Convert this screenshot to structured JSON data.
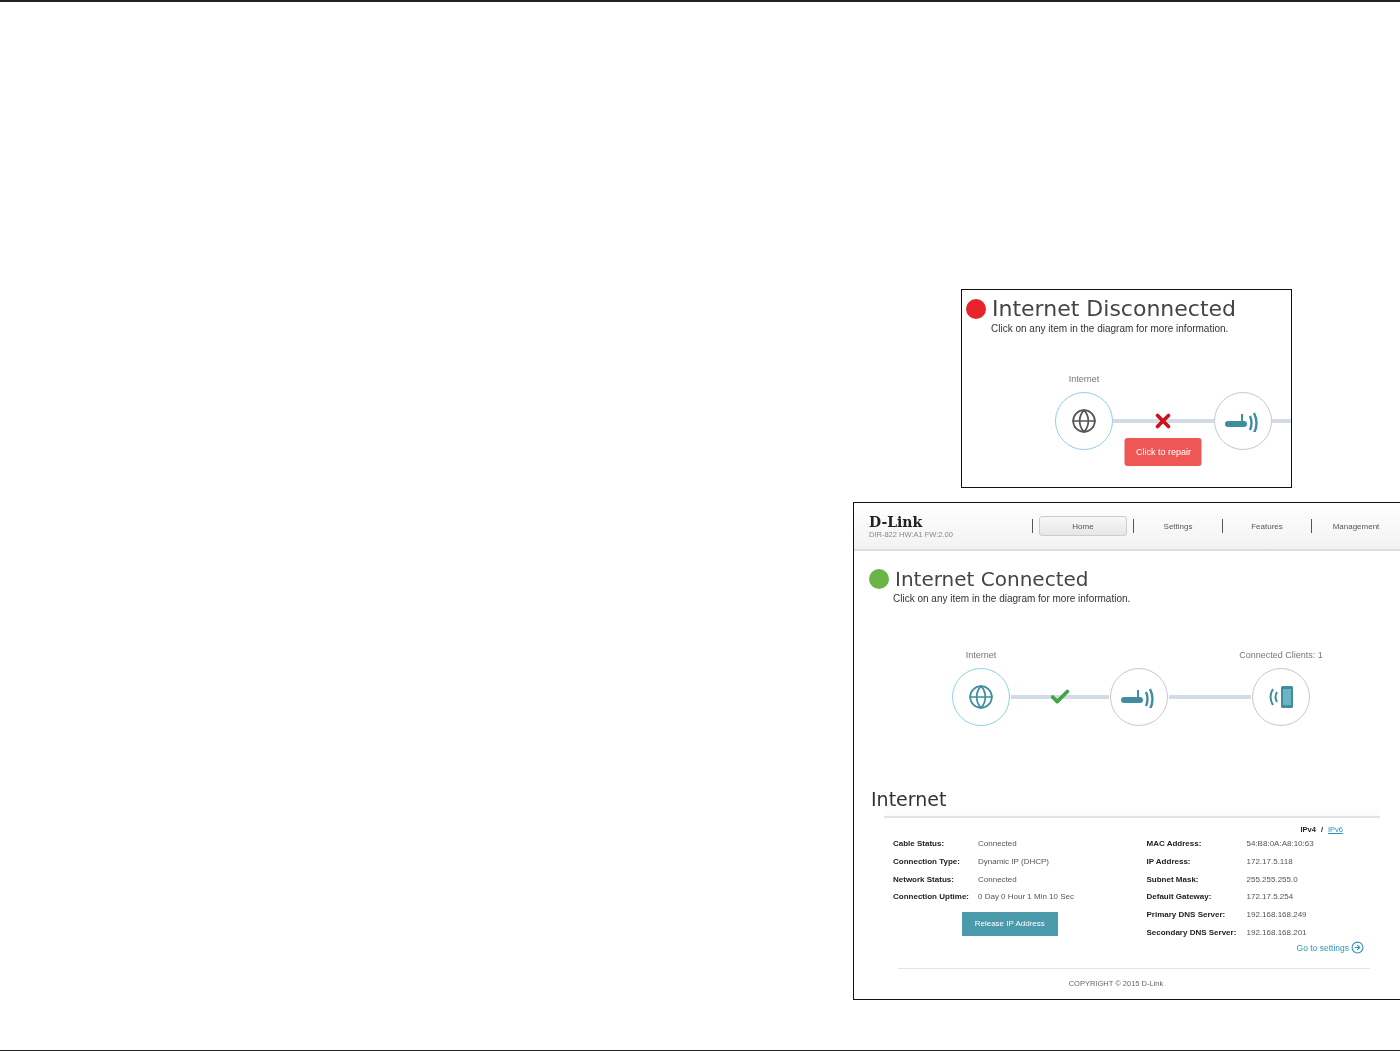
{
  "disconnected_panel": {
    "status": {
      "connected": false,
      "title": "Internet Disconnected"
    },
    "hint": "Click on any item in the diagram for more information.",
    "nodes": [
      {
        "kind": "globe",
        "label": "Internet"
      },
      {
        "kind": "router"
      }
    ],
    "link": {
      "broken": true
    },
    "repair_button": "Click to repair"
  },
  "router_page": {
    "header": {
      "logo": "D-Link",
      "model": "DIR-822 HW:A1 FW:2.00",
      "tabs": [
        {
          "label": "Home",
          "selected": true
        },
        {
          "label": "Settings",
          "selected": false
        },
        {
          "label": "Features",
          "selected": false
        },
        {
          "label": "Management",
          "selected": false
        }
      ]
    },
    "status": {
      "connected": true,
      "title": "Internet Connected"
    },
    "hint": "Click on any item in the diagram for more information.",
    "nodes": [
      {
        "kind": "globe",
        "label": "Internet"
      },
      {
        "kind": "router"
      },
      {
        "kind": "client",
        "label": "Connected Clients: 1"
      }
    ],
    "links": [
      {
        "ok": true
      },
      {
        "ok": false
      }
    ],
    "section_title": "Internet",
    "ip_toggle": {
      "ipv4": "IPv4",
      "separator": "/",
      "ipv6": "IPv6"
    },
    "left_fields": [
      {
        "label": "Cable Status:",
        "value": "Connected"
      },
      {
        "label": "Connection Type:",
        "value": "Dynamic IP (DHCP)"
      },
      {
        "label": "Network Status:",
        "value": "Connected"
      },
      {
        "label": "Connection Uptime:",
        "value": "0 Day 0 Hour 1 Min 10 Sec"
      }
    ],
    "release_button": "Release IP Address",
    "right_fields": [
      {
        "label": "MAC Address:",
        "value": "54:B8:0A:A8:10:63"
      },
      {
        "label": "IP Address:",
        "value": "172.17.5.118"
      },
      {
        "label": "Subnet Mask:",
        "value": "255.255.255.0"
      },
      {
        "label": "Default Gateway:",
        "value": "172.17.5.254"
      },
      {
        "label": "Primary DNS Server:",
        "value": "192.168.168.249"
      },
      {
        "label": "Secondary DNS Server:",
        "value": "192.168.168.201"
      }
    ],
    "settings_link": "Go to settings",
    "copyright": "COPYRIGHT © 2015 D-Link"
  }
}
